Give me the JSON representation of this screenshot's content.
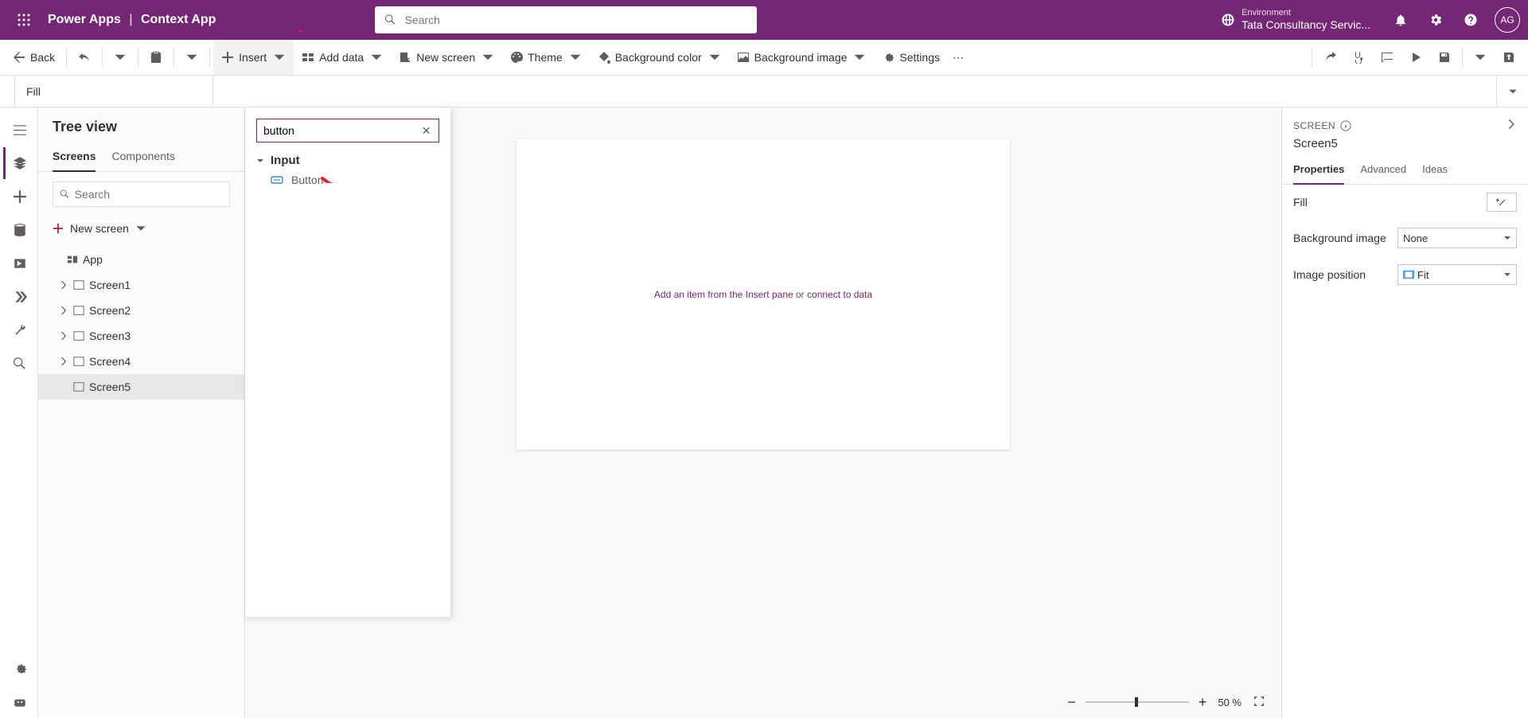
{
  "header": {
    "product": "Power Apps",
    "separator": "|",
    "appName": "Context App",
    "searchPlaceholder": "Search",
    "envLabel": "Environment",
    "envName": "Tata Consultancy Servic...",
    "avatar": "AG"
  },
  "commandBar": {
    "back": "Back",
    "insert": "Insert",
    "addData": "Add data",
    "newScreen": "New screen",
    "theme": "Theme",
    "bgColor": "Background color",
    "bgImage": "Background image",
    "settings": "Settings"
  },
  "formula": {
    "property": "Fill"
  },
  "tree": {
    "title": "Tree view",
    "tabs": {
      "screens": "Screens",
      "components": "Components"
    },
    "searchPlaceholder": "Search",
    "newScreen": "New screen",
    "app": "App",
    "items": [
      {
        "name": "Screen1"
      },
      {
        "name": "Screen2"
      },
      {
        "name": "Screen3"
      },
      {
        "name": "Screen4"
      },
      {
        "name": "Screen5",
        "selected": true
      }
    ]
  },
  "insertPopup": {
    "searchValue": "button",
    "groupLabel": "Input",
    "results": [
      {
        "label": "Button"
      }
    ]
  },
  "canvas": {
    "hintA": "Add an item from the Insert pane",
    "hintMid": " or ",
    "hintB": "connect to data",
    "zoom": "50  %"
  },
  "rightPanel": {
    "heading": "SCREEN",
    "name": "Screen5",
    "tabs": {
      "props": "Properties",
      "adv": "Advanced",
      "ideas": "Ideas"
    },
    "fill": "Fill",
    "bgImage": "Background image",
    "bgImageVal": "None",
    "imgPos": "Image position",
    "imgPosVal": "Fit"
  }
}
